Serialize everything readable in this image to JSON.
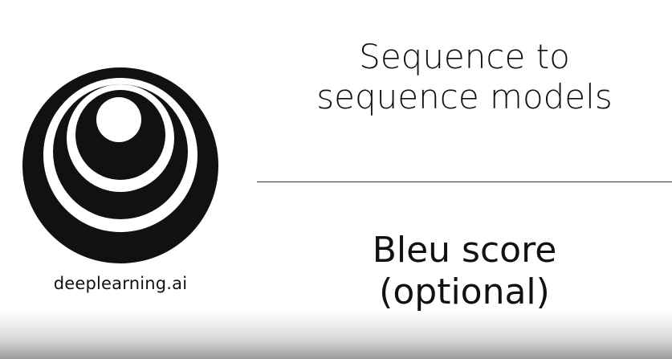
{
  "branding": {
    "site": "deeplearning.ai"
  },
  "title": {
    "line1": "Sequence to",
    "line2": "sequence models"
  },
  "subtitle": {
    "line1": "Bleu score",
    "line2": "(optional)"
  },
  "colors": {
    "logo": "#111111",
    "background": "#ffffff"
  }
}
